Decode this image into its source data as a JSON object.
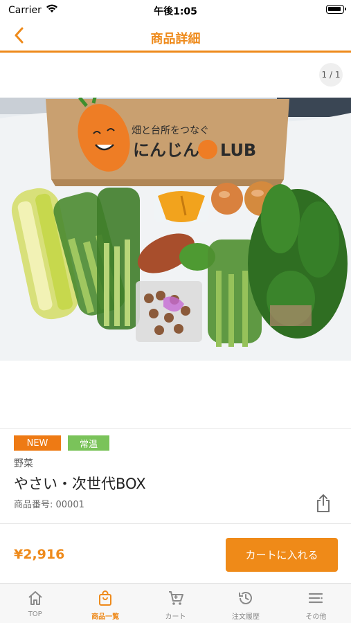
{
  "status_bar": {
    "carrier": "Carrier",
    "time": "午後1:05"
  },
  "header": {
    "title": "商品詳細"
  },
  "gallery": {
    "page_indicator": "1 / 1",
    "box_text": "畑と台所をつなぐ にんじんCLUB"
  },
  "product": {
    "badges": [
      {
        "label": "NEW",
        "color": "#ee7a14"
      },
      {
        "label": "常温",
        "color": "#7ac35a"
      }
    ],
    "category": "野菜",
    "name": "やさい・次世代BOX",
    "code": "商品番号: 00001",
    "price": "¥2,916"
  },
  "actions": {
    "add_to_cart_label": "カートに入れる"
  },
  "tab_bar": {
    "items": [
      {
        "label": "TOP",
        "icon": "home-icon",
        "active": false
      },
      {
        "label": "商品一覧",
        "icon": "shopping-bag-icon",
        "active": true
      },
      {
        "label": "カート",
        "icon": "cart-icon",
        "active": false
      },
      {
        "label": "注文履歴",
        "icon": "history-icon",
        "active": false
      },
      {
        "label": "その他",
        "icon": "menu-icon",
        "active": false
      }
    ]
  },
  "colors": {
    "accent": "#ee8a1b",
    "badge_new": "#ee7a14",
    "badge_temperature": "#7ac35a",
    "tab_inactive": "#8a8a8a"
  }
}
